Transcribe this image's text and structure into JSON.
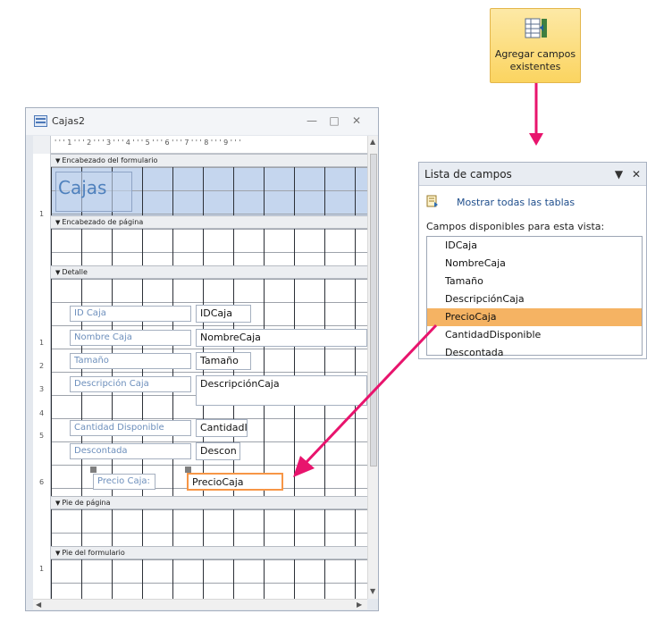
{
  "ribbon": {
    "button_label": "Agregar campos existentes"
  },
  "form_window": {
    "title": "Cajas2",
    "ruler_numbers": "' ' ' 1 ' ' ' 2 ' ' ' 3 ' ' ' 4 ' ' ' 5 ' ' ' 6 ' ' ' 7 ' ' ' 8 ' ' ' 9 ' ' '",
    "sections": {
      "form_header": "Encabezado del formulario",
      "page_header": "Encabezado de página",
      "detail": "Detalle",
      "page_footer": "Pie de página",
      "form_footer": "Pie del formulario"
    },
    "header_title": "Cajas",
    "labels": {
      "id": "ID Caja",
      "name": "Nombre Caja",
      "size": "Tamaño",
      "desc": "Descripción Caja",
      "qty": "Cantidad Disponible",
      "disc": "Descontada",
      "price": "Precio Caja:"
    },
    "textboxes": {
      "id": "IDCaja",
      "name": "NombreCaja",
      "size": "Tamaño",
      "desc": "DescripciónCaja",
      "qty": "CantidadI",
      "disc": "Descon",
      "price": "PrecioCaja"
    },
    "left_ruler": [
      "1",
      "2",
      "3",
      "4",
      "5",
      "6"
    ]
  },
  "field_list": {
    "title": "Lista de campos",
    "show_all_link": "Mostrar todas las tablas",
    "available_label": "Campos disponibles para esta vista:",
    "fields": [
      "IDCaja",
      "NombreCaja",
      "Tamaño",
      "DescripciónCaja",
      "PrecioCaja",
      "CantidadDisponible",
      "Descontada"
    ],
    "selected_field": "PrecioCaja"
  },
  "colors": {
    "accent_arrow": "#e8146d",
    "selection_orange": "#f79646",
    "ribbon_button": "#fbd460",
    "header_section": "#c5d6ee"
  }
}
